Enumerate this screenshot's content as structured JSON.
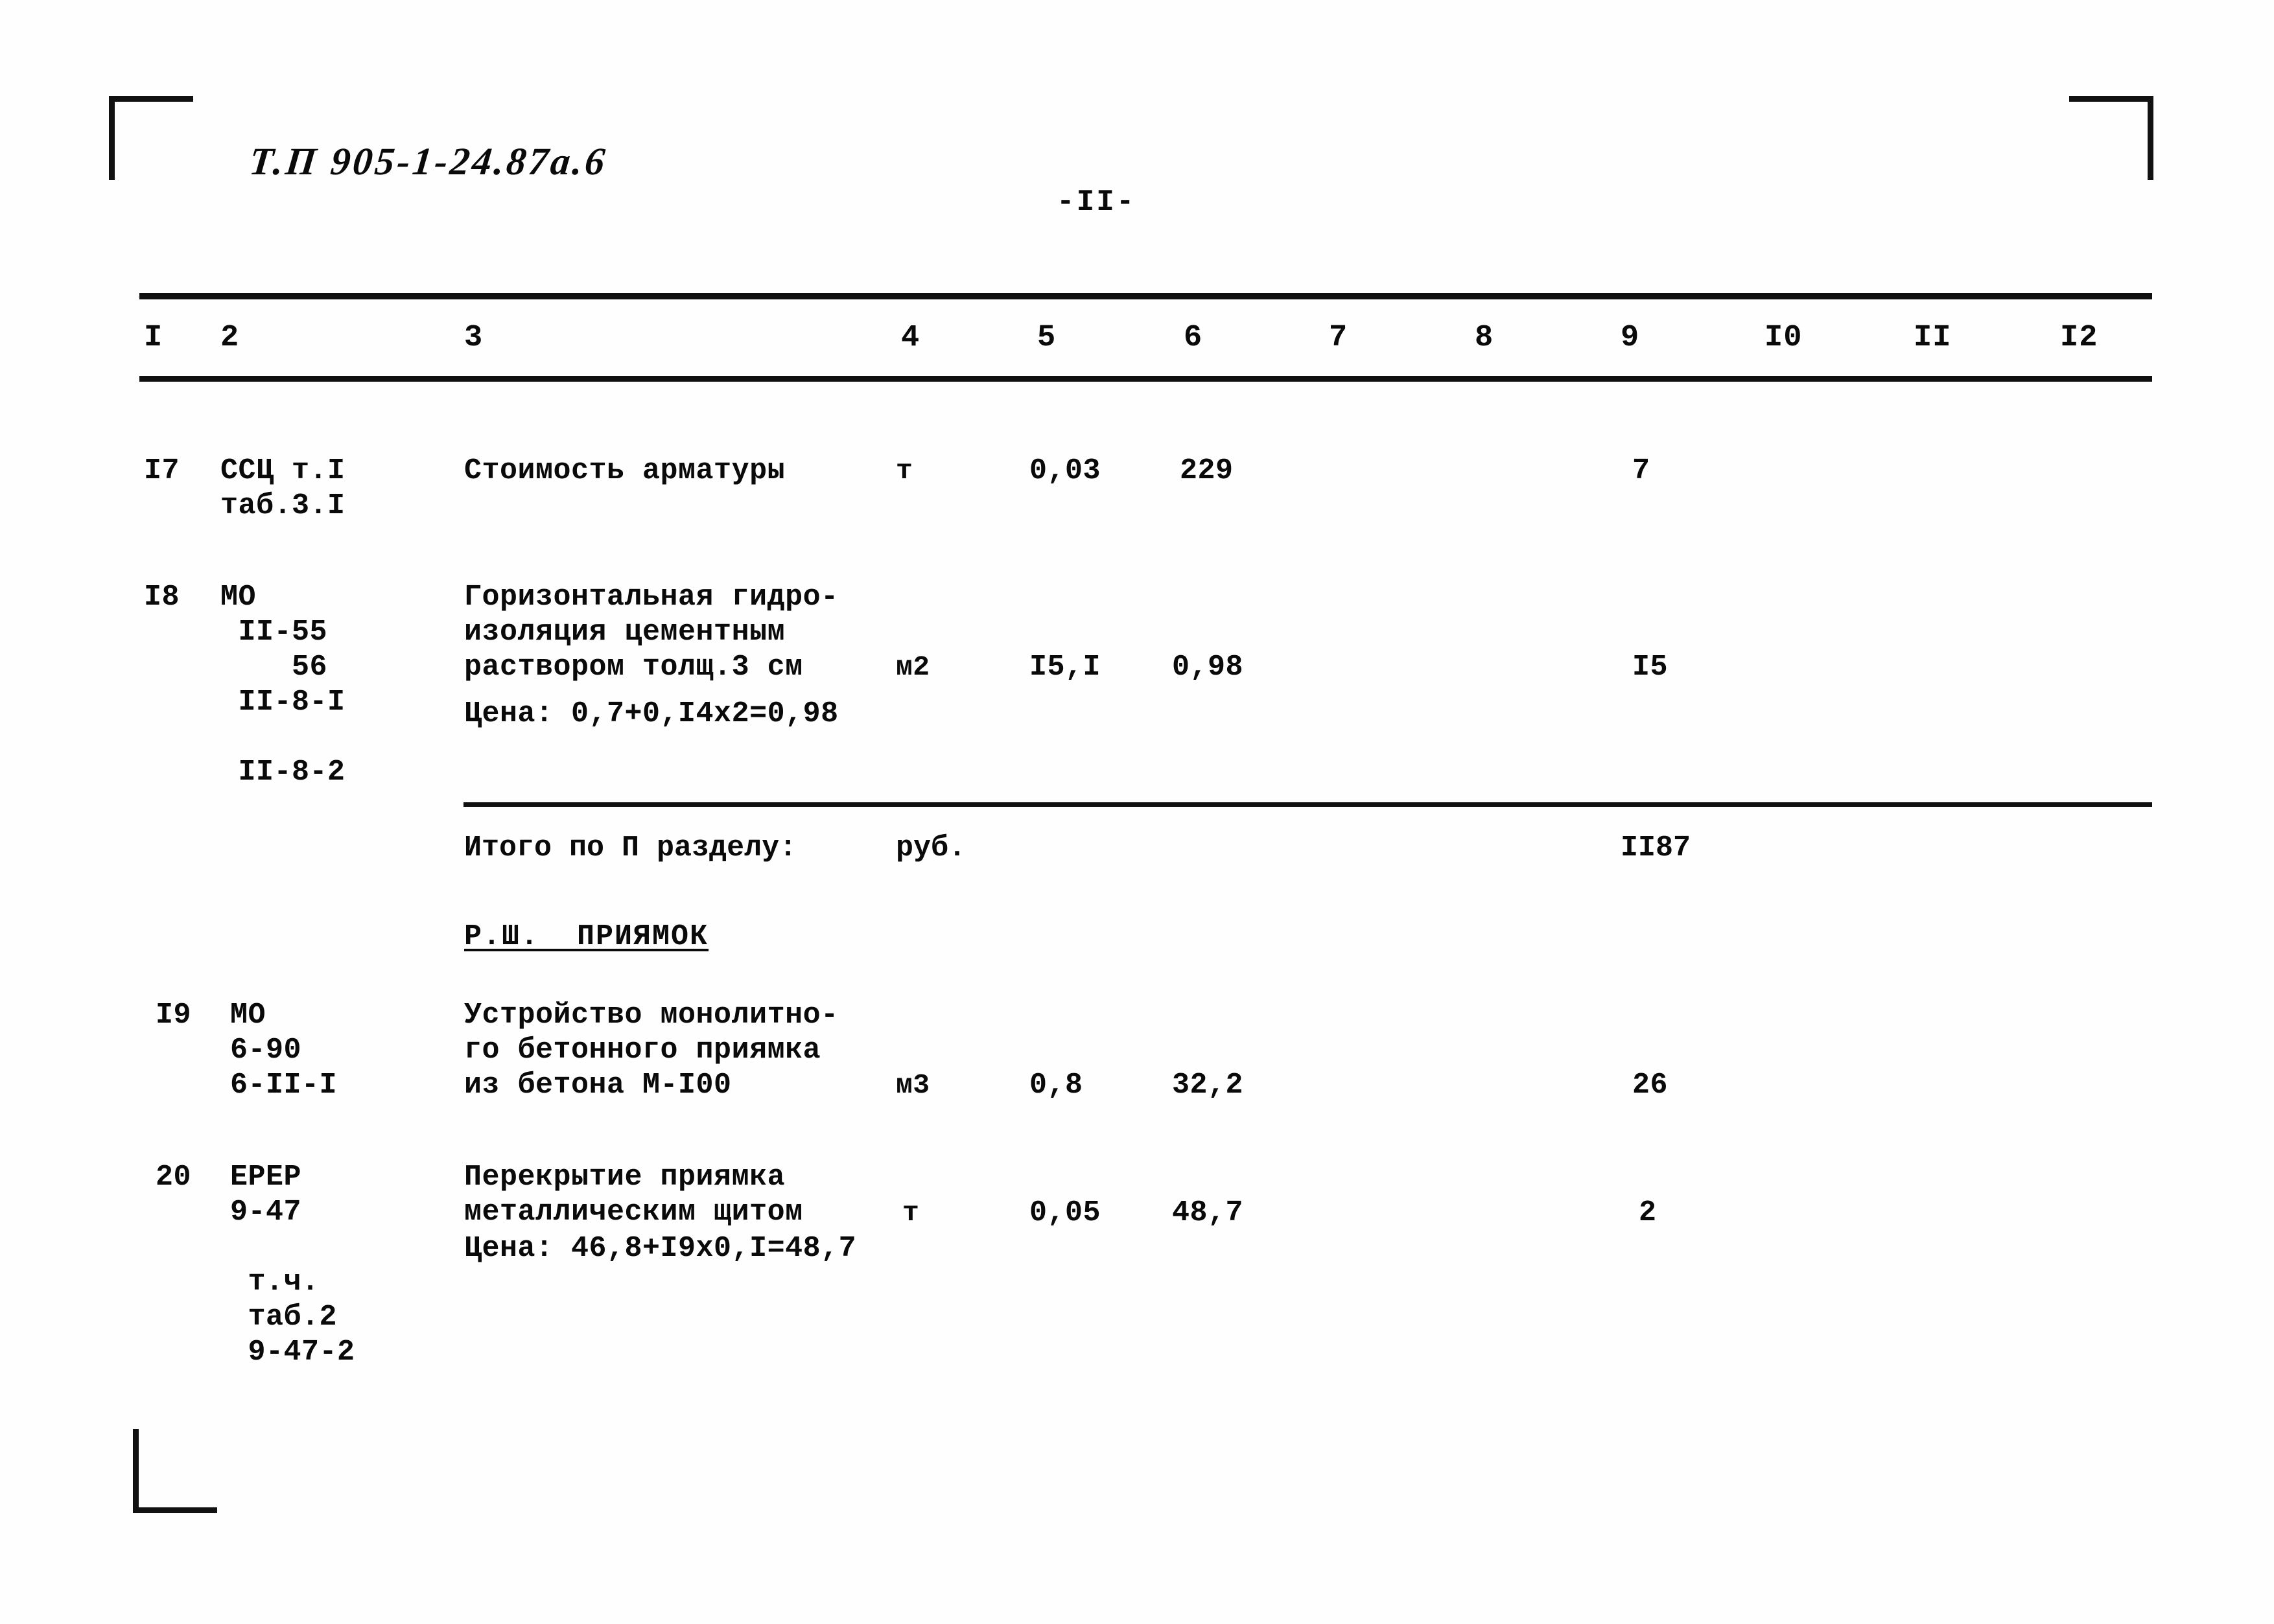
{
  "header": {
    "doc_code": "Т.П  905-1-24.87а.6",
    "page_number": "-II-"
  },
  "table": {
    "column_headers": [
      "I",
      "2",
      "3",
      "4",
      "5",
      "6",
      "7",
      "8",
      "9",
      "I0",
      "II",
      "I2"
    ],
    "rows": [
      {
        "no": "I7",
        "code": "ССЦ т.I\nтаб.3.I",
        "description": "Стоимость арматуры",
        "unit": "т",
        "qty": "0,03",
        "price": "229",
        "c7": "",
        "c8": "",
        "total": "7",
        "c10": "",
        "c11": "",
        "c12": ""
      },
      {
        "no": "I8",
        "code": "МО\n II-55\n    56\n II-8-I\n\n II-8-2",
        "description": "Горизонтальная гидро-\nизоляция цементным\nраствором толщ.3 см",
        "note": "Цена: 0,7+0,I4x2=0,98",
        "unit": "м2",
        "qty": "I5,I",
        "price": "0,98",
        "c7": "",
        "c8": "",
        "total": "I5",
        "c10": "",
        "c11": "",
        "c12": ""
      },
      {
        "no": "I9",
        "code": "МО\n6-90\n6-II-I",
        "description": "Устройство монолитно-\nго бетонного приямка\nиз бетона М-I00",
        "unit": "м3",
        "qty": "0,8",
        "price": "32,2",
        "c7": "",
        "c8": "",
        "total": "26",
        "c10": "",
        "c11": "",
        "c12": ""
      },
      {
        "no": "20",
        "code": "ЕРЕР\n9-47\n\n т.ч.\n таб.2\n 9-47-2",
        "description": "Перекрытие приямка\nметаллическим щитом",
        "note": "Цена: 46,8+I9х0,I=48,7",
        "unit": "т",
        "qty": "0,05",
        "price": "48,7",
        "c7": "",
        "c8": "",
        "total": "2",
        "c10": "",
        "c11": "",
        "c12": ""
      }
    ],
    "subtotal": {
      "label": "Итого по П разделу:",
      "unit": "руб.",
      "value": "II87"
    },
    "section_heading": "Р.Ш.  ПРИЯМОК"
  }
}
